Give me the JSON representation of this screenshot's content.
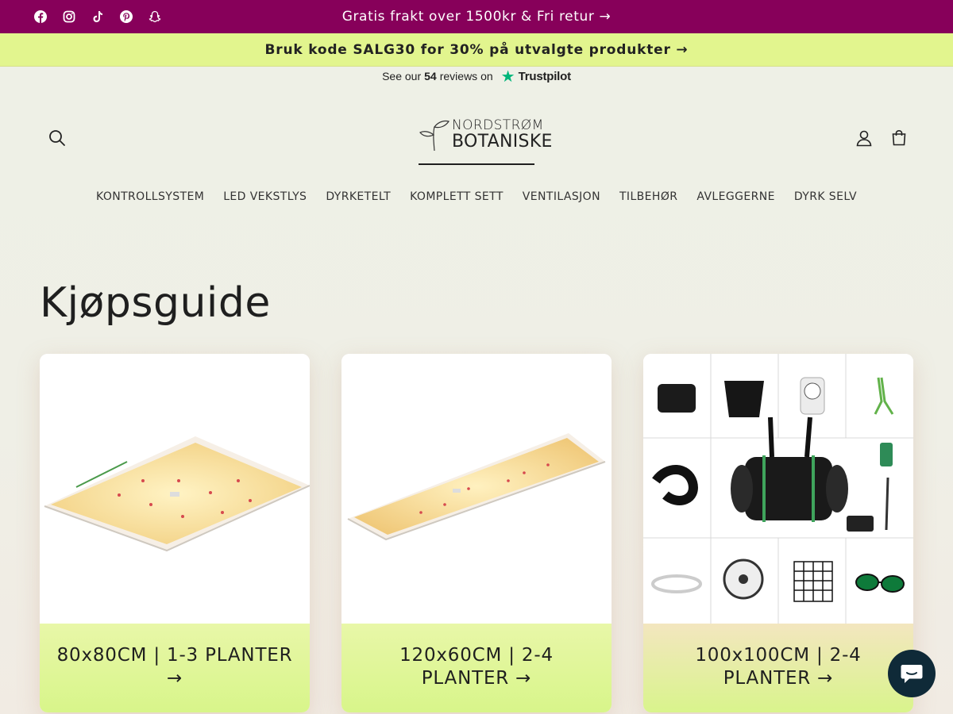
{
  "topbar": {
    "message": "Gratis frakt over 1500kr & Fri retur →",
    "social": [
      "facebook-icon",
      "instagram-icon",
      "tiktok-icon",
      "pinterest-icon",
      "snapchat-icon"
    ]
  },
  "promobar": {
    "message": "Bruk kode SALG30 for 30% på utvalgte produkter →"
  },
  "trustpilot": {
    "prefix": "See our",
    "count": "54",
    "suffix": "reviews on",
    "brand": "Trustpilot"
  },
  "header": {
    "logo_line1": "NORDSTRØM",
    "logo_line2": "BOTANISKE",
    "icons": [
      "search-icon",
      "account-icon",
      "cart-icon"
    ]
  },
  "nav": {
    "items": [
      "KONTROLLSYSTEM",
      "LED VEKSTLYS",
      "DYRKETELT",
      "KOMPLETT SETT",
      "VENTILASJON",
      "TILBEHØR",
      "AVLEGGERNE",
      "DYRK SELV"
    ]
  },
  "main": {
    "title": "Kjøpsguide",
    "cards": [
      {
        "label": "80x80CM | 1-3 PLANTER →"
      },
      {
        "label": "120x60CM | 2-4 PLANTER →"
      },
      {
        "label": "100x100CM | 2-4 PLANTER →"
      }
    ]
  },
  "colors": {
    "topbar": "#87005a",
    "promobar": "#e2f58e",
    "chat": "#0f2a38",
    "accent_green": "#d8f58a"
  }
}
